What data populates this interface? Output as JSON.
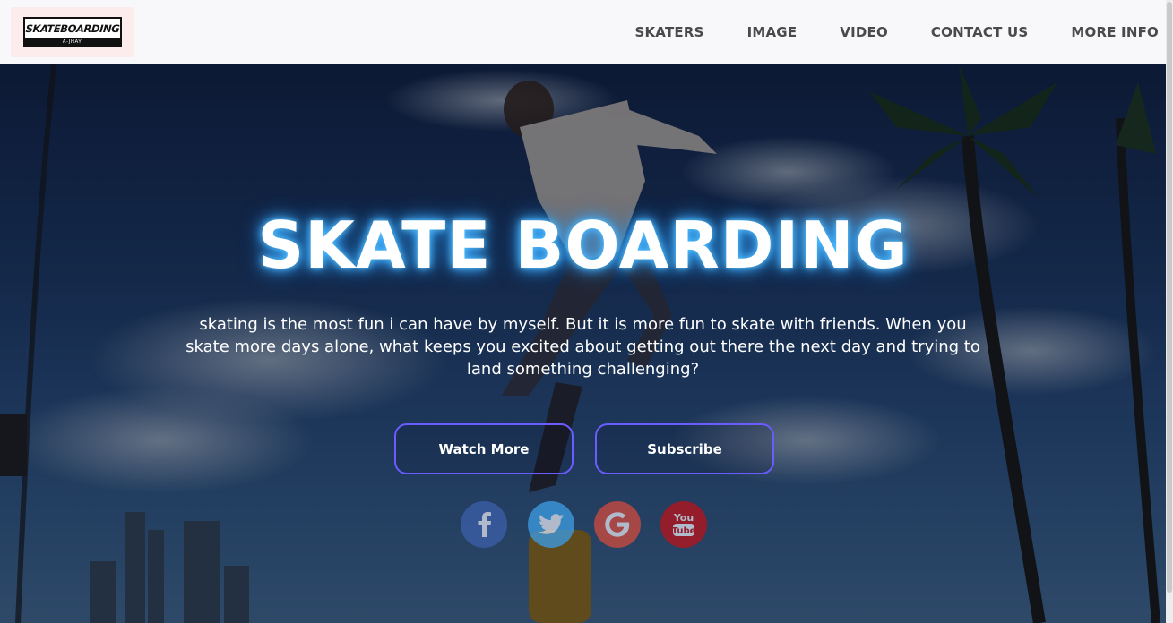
{
  "header": {
    "logo": {
      "title": "SKATEBOARDING",
      "subtitle": "A-JHAY"
    },
    "nav": [
      "SKATERS",
      "IMAGE",
      "VIDEO",
      "CONTACT US",
      "MORE INFO"
    ]
  },
  "hero": {
    "title": "SKATE BOARDING",
    "text": "skating is the most fun i can have by myself. But it is more fun to skate with friends. When you skate more days alone, what keeps you excited about getting out there the next day and trying to land something challenging?",
    "buttons": {
      "watch": "Watch More",
      "subscribe": "Subscribe"
    },
    "social": [
      {
        "name": "facebook-icon",
        "glyph": "f",
        "color": "#3b5ea8"
      },
      {
        "name": "twitter-icon",
        "glyph": "twitter-bird",
        "color": "#3d9ae0"
      },
      {
        "name": "google-icon",
        "glyph": "G",
        "color": "#c94a3f"
      },
      {
        "name": "youtube-icon",
        "glyph": "You Tube",
        "color": "#b3141c"
      }
    ]
  },
  "colors": {
    "accent": "#6a5cff",
    "glow": "#3aa8ff",
    "nav_text": "#4a4a4a",
    "header_bg": "#f8f8fa"
  }
}
